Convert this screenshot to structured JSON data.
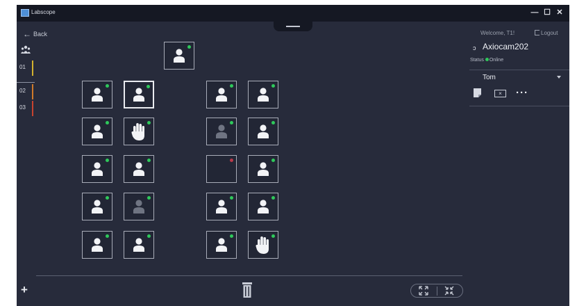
{
  "window": {
    "title": "Labscope",
    "minimize": "—",
    "maximize": "☐",
    "close": "✕"
  },
  "nav": {
    "back_label": "Back",
    "back_arrow": "←"
  },
  "groups": [
    {
      "label": "01",
      "color": "#d4b22e"
    },
    {
      "label": "02",
      "color": "#d07a2a"
    },
    {
      "label": "03",
      "color": "#c8432e"
    }
  ],
  "right_panel": {
    "welcome": "Welcome, T1!",
    "logout_label": "Logout",
    "device_name": "Axiocam202",
    "device_icon": "ↄ",
    "status_label": "Status",
    "status_value": "Online",
    "user_name": "Tom",
    "more_label": "···",
    "close_symbol": "×"
  },
  "toolbar": {
    "add_label": "+"
  },
  "seats": [
    {
      "id": "teacher",
      "state": "user",
      "online": true
    },
    {
      "id": "L1",
      "state": "user",
      "online": true
    },
    {
      "id": "L2",
      "state": "user",
      "online": true,
      "selected": true
    },
    {
      "id": "R1",
      "state": "user",
      "online": true
    },
    {
      "id": "R2",
      "state": "user",
      "online": true
    },
    {
      "id": "L3",
      "state": "user",
      "online": true
    },
    {
      "id": "L4",
      "state": "hand",
      "online": true
    },
    {
      "id": "R3",
      "state": "user-dim",
      "online": true
    },
    {
      "id": "R4",
      "state": "user",
      "online": true
    },
    {
      "id": "L5",
      "state": "user",
      "online": true
    },
    {
      "id": "L6",
      "state": "user",
      "online": true
    },
    {
      "id": "R5",
      "state": "empty",
      "online": false
    },
    {
      "id": "R6",
      "state": "user",
      "online": true
    },
    {
      "id": "L7",
      "state": "user",
      "online": true
    },
    {
      "id": "L8",
      "state": "user-dim",
      "online": true
    },
    {
      "id": "R7",
      "state": "user",
      "online": true
    },
    {
      "id": "R8",
      "state": "user",
      "online": true
    },
    {
      "id": "L9",
      "state": "user",
      "online": true
    },
    {
      "id": "L10",
      "state": "user",
      "online": true
    },
    {
      "id": "R9",
      "state": "user",
      "online": true
    },
    {
      "id": "R10",
      "state": "hand",
      "online": true
    }
  ],
  "colors": {
    "online": "#2fc95b",
    "offline": "#b83a4a",
    "background": "#272b3b"
  }
}
